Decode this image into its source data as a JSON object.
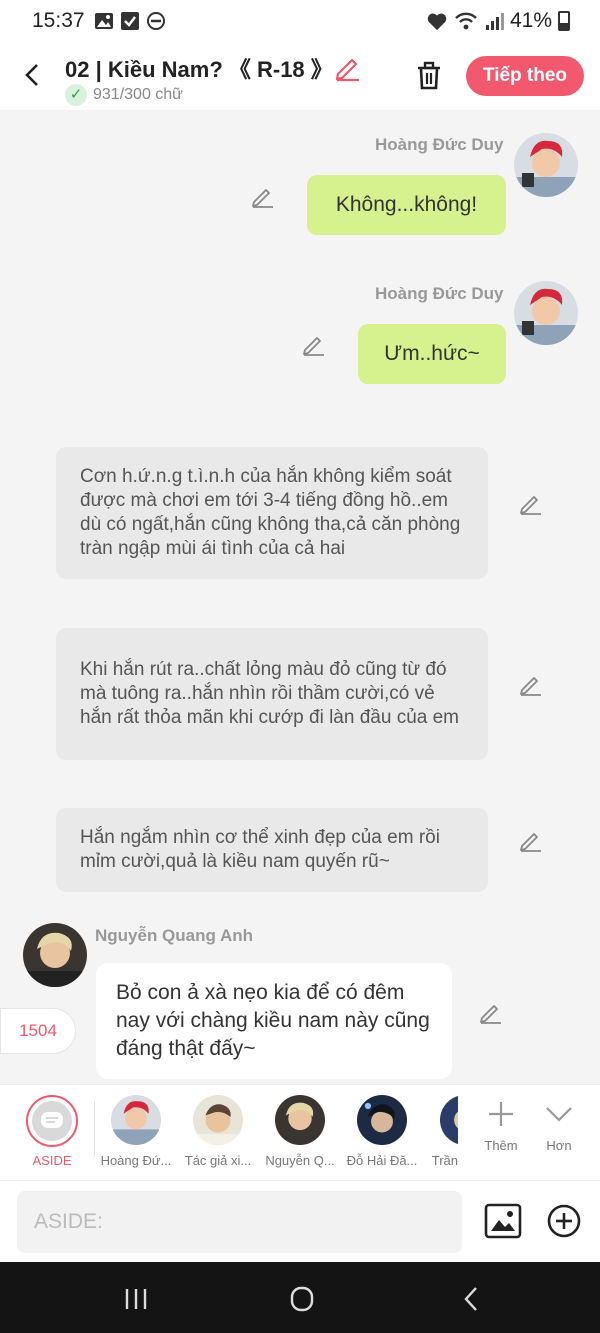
{
  "status_bar": {
    "time": "15:37",
    "battery": "41%"
  },
  "header": {
    "title": "02 | Kiều Nam? 《 R-18 》",
    "word_count": "931/300 chữ",
    "next_label": "Tiếp theo"
  },
  "messages": {
    "m1": {
      "sender": "Hoàng Đức Duy",
      "text": "Không...không!"
    },
    "m2": {
      "sender": "Hoàng Đức Duy",
      "text": "Ưm..hức~"
    },
    "n1": "Cơn h.ứ.n.g t.ì.n.h của hắn không kiểm soát được mà chơi em tới 3-4 tiếng đồng hồ..em dù có ngất,hắn cũng không tha,cả căn phòng tràn ngập mùi ái tình của cả hai",
    "n2": "Khi hắn rút ra..chất lỏng màu đỏ cũng từ đó mà tuông ra..hắn nhìn rồi thầm cười,có vẻ hắn rất thỏa mãn khi cướp đi làn đầu của em",
    "n3": "Hắn ngắm nhìn cơ thể xinh đẹp của em rồi mỉm cười,quả là kiều nam quyến rũ~",
    "m3": {
      "sender": "Nguyễn Quang Anh",
      "text": "Bỏ con ả xà nẹo kia để có đêm nay với chàng kiều nam này cũng đáng thật đấy~"
    }
  },
  "counter": "1504",
  "characters": {
    "aside_label": "ASIDE",
    "items": [
      {
        "label": "Hoàng Đứ..."
      },
      {
        "label": "Tác giả xi..."
      },
      {
        "label": "Nguyễn Q..."
      },
      {
        "label": "Đỗ Hải Đă..."
      },
      {
        "label": "Trần"
      }
    ],
    "add_label": "Thêm",
    "more_label": "Hơn"
  },
  "input": {
    "placeholder": "ASIDE:"
  },
  "colors": {
    "accent": "#f2586e",
    "bubble_green": "#d5f28f",
    "narration_bg": "#e9e9e9",
    "chat_bg": "#f4f4f4"
  }
}
